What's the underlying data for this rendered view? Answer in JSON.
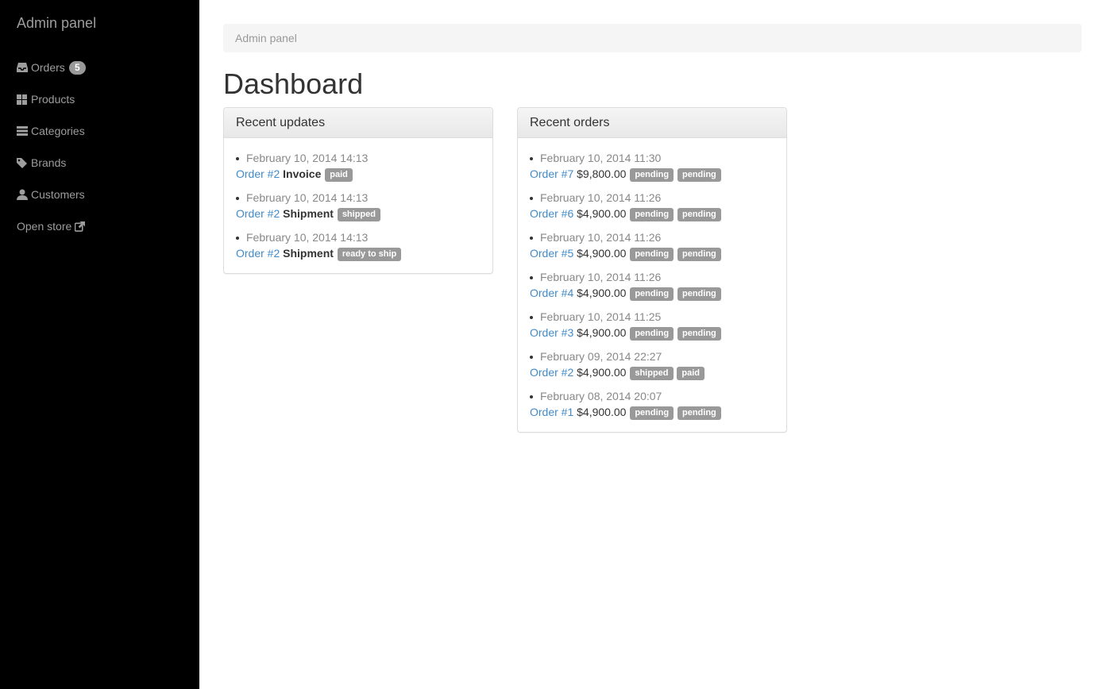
{
  "sidebar": {
    "brand": "Admin panel",
    "items": [
      {
        "label": "Orders",
        "icon": "inbox-icon",
        "badge": "5"
      },
      {
        "label": "Products",
        "icon": "grid-icon"
      },
      {
        "label": "Categories",
        "icon": "list-icon"
      },
      {
        "label": "Brands",
        "icon": "tags-icon"
      },
      {
        "label": "Customers",
        "icon": "user-icon"
      },
      {
        "label": "Open store",
        "icon": "external-link-icon"
      }
    ]
  },
  "breadcrumb": "Admin panel",
  "page_title": "Dashboard",
  "recent_updates": {
    "title": "Recent updates",
    "items": [
      {
        "date": "February 10, 2014 14:13",
        "order": "Order #2",
        "type": "Invoice",
        "status": "paid"
      },
      {
        "date": "February 10, 2014 14:13",
        "order": "Order #2",
        "type": "Shipment",
        "status": "shipped"
      },
      {
        "date": "February 10, 2014 14:13",
        "order": "Order #2",
        "type": "Shipment",
        "status": "ready to ship"
      }
    ]
  },
  "recent_orders": {
    "title": "Recent orders",
    "items": [
      {
        "date": "February 10, 2014 11:30",
        "order": "Order #7",
        "amount": "$9,800.00",
        "shipment_status": "pending",
        "payment_status": "pending"
      },
      {
        "date": "February 10, 2014 11:26",
        "order": "Order #6",
        "amount": "$4,900.00",
        "shipment_status": "pending",
        "payment_status": "pending"
      },
      {
        "date": "February 10, 2014 11:26",
        "order": "Order #5",
        "amount": "$4,900.00",
        "shipment_status": "pending",
        "payment_status": "pending"
      },
      {
        "date": "February 10, 2014 11:26",
        "order": "Order #4",
        "amount": "$4,900.00",
        "shipment_status": "pending",
        "payment_status": "pending"
      },
      {
        "date": "February 10, 2014 11:25",
        "order": "Order #3",
        "amount": "$4,900.00",
        "shipment_status": "pending",
        "payment_status": "pending"
      },
      {
        "date": "February 09, 2014 22:27",
        "order": "Order #2",
        "amount": "$4,900.00",
        "shipment_status": "shipped",
        "payment_status": "paid"
      },
      {
        "date": "February 08, 2014 20:07",
        "order": "Order #1",
        "amount": "$4,900.00",
        "shipment_status": "pending",
        "payment_status": "pending"
      }
    ]
  },
  "colors": {
    "sidebar_bg": "#000000",
    "link": "#428bca",
    "label_bg": "#999999"
  }
}
